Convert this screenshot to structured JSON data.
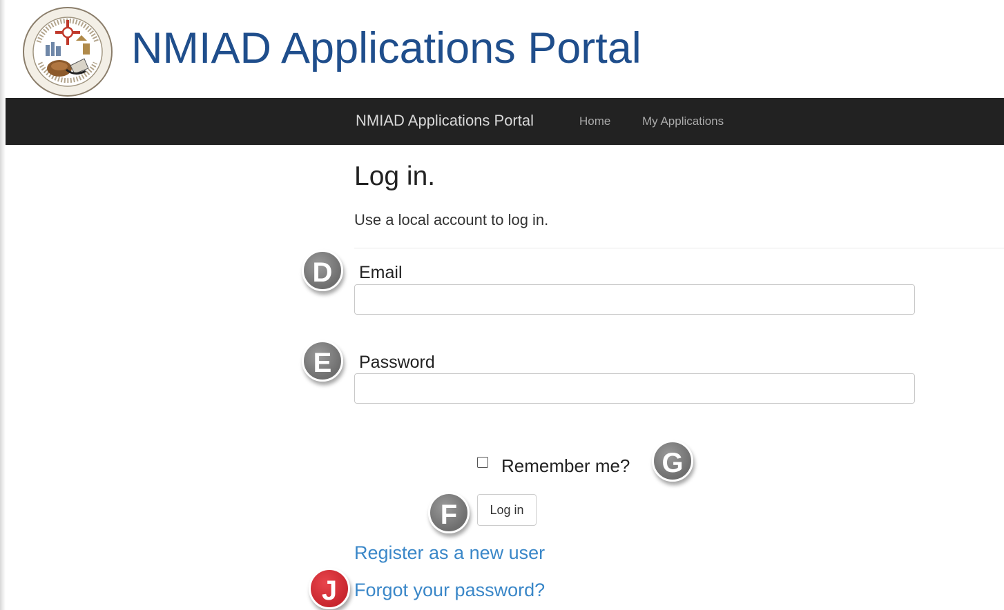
{
  "header": {
    "site_title": "NMIAD Applications Portal",
    "seal_icon": "state-seal-icon"
  },
  "navbar": {
    "brand": "NMIAD Applications Portal",
    "links": [
      "Home",
      "My Applications"
    ]
  },
  "login": {
    "heading": "Log in.",
    "subheading": "Use a local account to log in.",
    "email_label": "Email",
    "email_value": "",
    "password_label": "Password",
    "password_value": "",
    "remember_label": "Remember me?",
    "remember_checked": false,
    "submit_label": "Log in",
    "register_link": "Register as a new user",
    "forgot_link": "Forgot your password?"
  },
  "annotations": [
    "D",
    "E",
    "G",
    "F",
    "J"
  ],
  "colors": {
    "title_blue": "#1f4e8c",
    "navbar_bg": "#222222",
    "link_blue": "#3a87c8",
    "badge_gray": "#7a7a7a",
    "badge_red": "#d22f36"
  }
}
